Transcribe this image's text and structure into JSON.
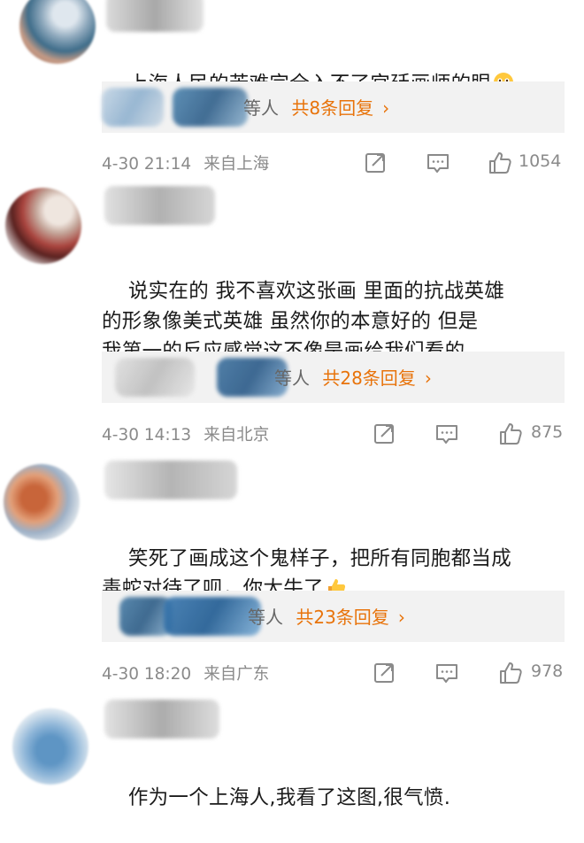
{
  "comments": [
    {
      "text": "上海人民的苦难完全入不了宫廷画师的眼",
      "emoji": "flushed-face",
      "reply_suffix": "等人",
      "reply_count": "共8条回复",
      "date": "4-30 21:14",
      "location": "来自上海",
      "likes": "1054"
    },
    {
      "text": "说实在的 我不喜欢这张画 里面的抗战英雄\n的形象像美式英雄 虽然你的本意好的 但是\n我第一的反应感觉这不像是画给我们看的",
      "reply_suffix": "等人",
      "reply_count": "共28条回复",
      "date": "4-30 14:13",
      "location": "来自北京",
      "likes": "875"
    },
    {
      "text": "笑死了画成这个鬼样子，把所有同胞都当成\n毒蛇对待了呗，你太牛了",
      "emoji": "thumbs-up",
      "reply_suffix": "等人",
      "reply_count": "共23条回复",
      "date": "4-30 18:20",
      "location": "来自广东",
      "likes": "978"
    },
    {
      "text": "作为一个上海人,我看了这图,很气愤."
    }
  ],
  "reply_chevron": "›",
  "colors": {
    "accent": "#e8730a",
    "meta": "#8a8a8a",
    "reply_bg": "#f2f2f2"
  }
}
